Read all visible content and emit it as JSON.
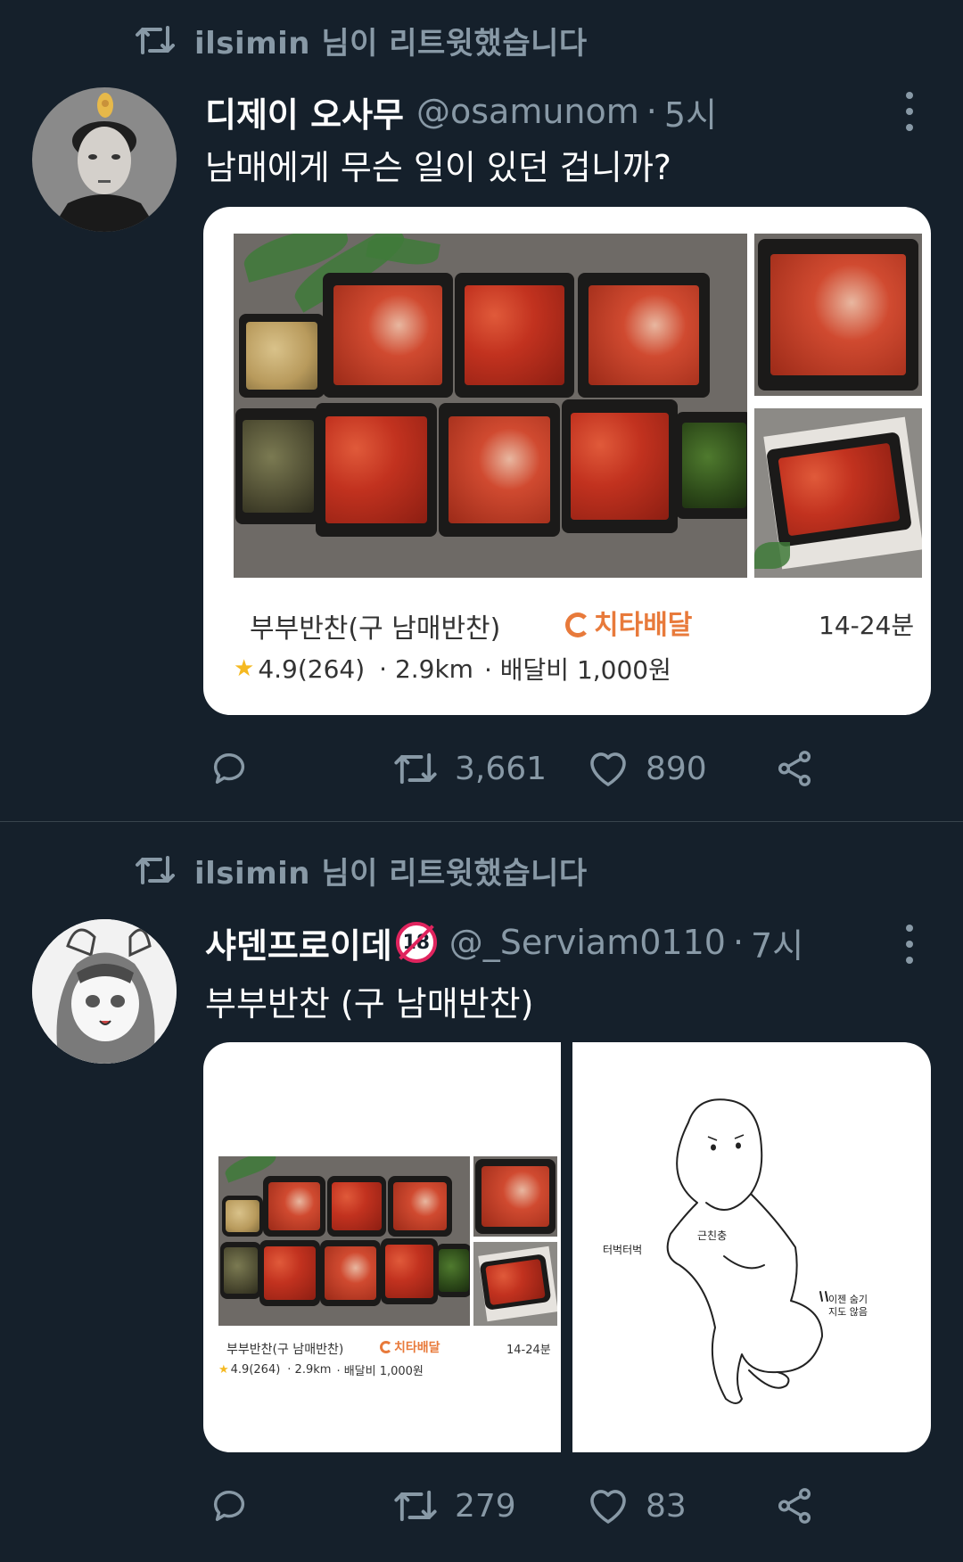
{
  "tweets": [
    {
      "retweet_label": "ilsimin 님이 리트윗했습니다",
      "display_name": "디제이 오사무",
      "handle": "@osamunom",
      "separator": "·",
      "time": "5시",
      "text": "남매에게 무슨 일이 있던 겁니까?",
      "card": {
        "title": "부부반찬(구 남매반찬)",
        "brand": "치타배달",
        "eta": "14-24분",
        "star": "★",
        "rating": "4.9(264)",
        "distance": "· 2.9km",
        "fee": "· 배달비 1,000원"
      },
      "retweet_count": "3,661",
      "like_count": "890"
    },
    {
      "retweet_label": "ilsimin 님이 리트윗했습니다",
      "display_name": "샤덴프로이데",
      "badge": "18",
      "handle": "@_Serviam0110",
      "separator": "·",
      "time": "7시",
      "text": "부부반찬 (구 남매반찬)",
      "card_left": {
        "title": "부부반찬(구 남매반찬)",
        "brand": "치타배달",
        "eta": "14-24분",
        "star": "★",
        "rating": "4.9(264)",
        "distance": "· 2.9km",
        "fee": "· 배달비 1,000원"
      },
      "card_right": {
        "label_left": "터벅터벅",
        "label_chest": "근친충",
        "label_right": "이젠 숨기지도 않음"
      },
      "retweet_count": "279",
      "like_count": "83"
    }
  ],
  "colors": {
    "background": "#15202b",
    "secondary_text": "#8899a6",
    "divider": "#38444d",
    "brand": "#e87a3b"
  },
  "icons": [
    "retweet-icon",
    "more-icon",
    "reply-icon",
    "heart-icon",
    "share-icon"
  ]
}
